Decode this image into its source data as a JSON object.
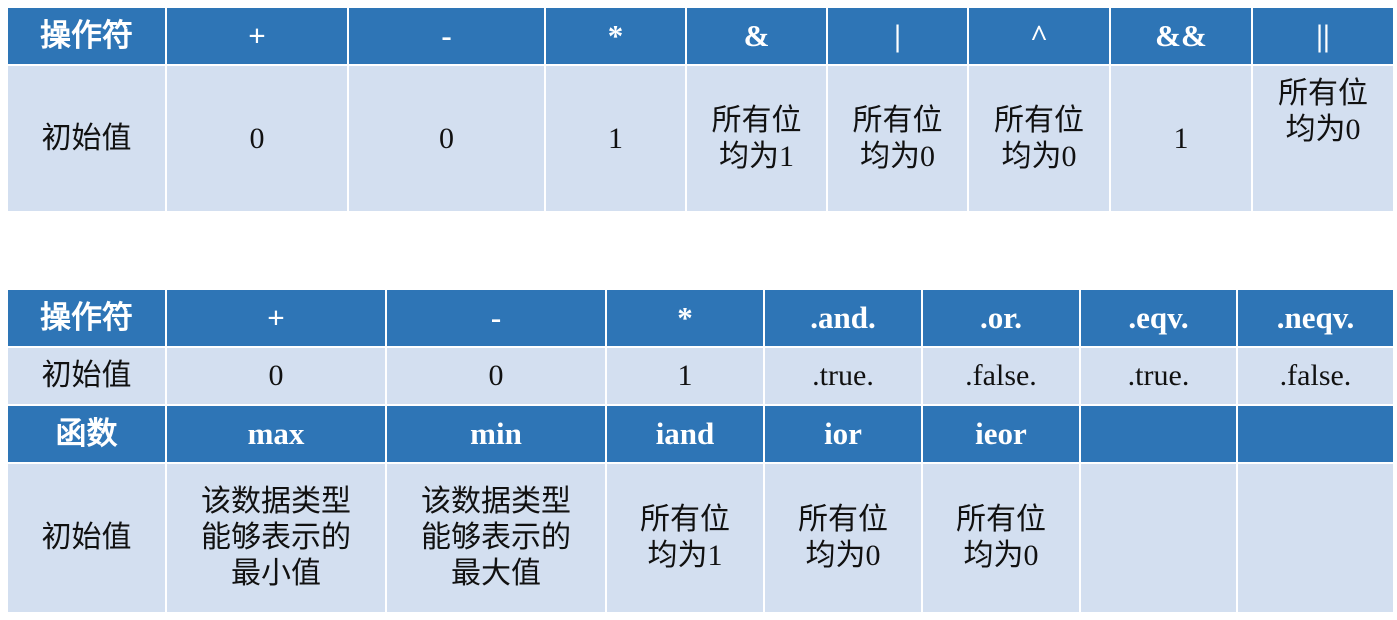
{
  "table1": {
    "header": [
      "操作符",
      "+",
      "-",
      "*",
      "&",
      "|",
      "^",
      "&&",
      "||"
    ],
    "row": [
      [
        "初始值"
      ],
      [
        "0"
      ],
      [
        "0"
      ],
      [
        "1"
      ],
      [
        "所有位",
        "均为1"
      ],
      [
        "所有位",
        "均为0"
      ],
      [
        "所有位",
        "均为0"
      ],
      [
        "1"
      ],
      [
        "所有位",
        "均为0"
      ]
    ]
  },
  "table2": {
    "header1": [
      "操作符",
      "+",
      "-",
      "*",
      ".and.",
      ".or.",
      ".eqv.",
      ".neqv."
    ],
    "row1": [
      "初始值",
      "0",
      "0",
      "1",
      ".true.",
      ".false.",
      ".true.",
      ".false."
    ],
    "header2": [
      "函数",
      "max",
      "min",
      "iand",
      "ior",
      "ieor",
      "",
      ""
    ],
    "row2": [
      [
        "初始值"
      ],
      [
        "该数据类型",
        "能够表示的",
        "最小值"
      ],
      [
        "该数据类型",
        "能够表示的",
        "最大值"
      ],
      [
        "所有位",
        "均为1"
      ],
      [
        "所有位",
        "均为0"
      ],
      [
        "所有位",
        "均为0"
      ],
      [],
      []
    ]
  }
}
